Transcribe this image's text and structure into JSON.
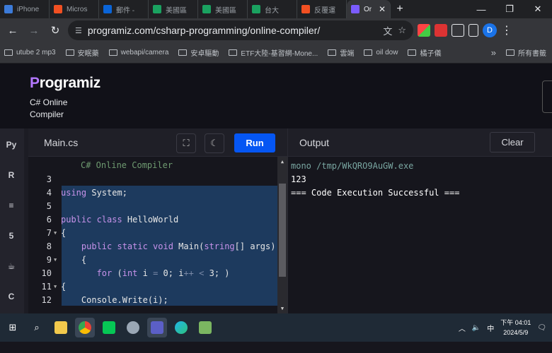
{
  "browser": {
    "tabs": [
      {
        "label": "iPhone",
        "color": "#3c7bd9"
      },
      {
        "label": "Micros",
        "color": "#f25022"
      },
      {
        "label": "郵件 -",
        "color": "#0a64d8"
      },
      {
        "label": "美國區",
        "color": "#1aa260"
      },
      {
        "label": "美國區",
        "color": "#1aa260"
      },
      {
        "label": "台大",
        "color": "#1aa260"
      },
      {
        "label": "反覆運",
        "color": "#f25022"
      },
      {
        "label": "Or",
        "color": "#7b5cff"
      }
    ],
    "new_tab": "+",
    "window_controls": {
      "minimize": "—",
      "restore": "❐",
      "close": "✕"
    },
    "url": "programiz.com/csharp-programming/online-compiler/",
    "avatar_letter": "D"
  },
  "bookmarks": {
    "items": [
      "utube 2 mp3",
      "安眠藥",
      "webapi/camera",
      "安卓驅動",
      "ETF大陸-基習網-Mone...",
      "雲端",
      "oil dow",
      "橘子儀"
    ],
    "overflow": "»",
    "all_bookmarks": "所有書籤"
  },
  "header": {
    "logo_prefix": "P",
    "logo_rest": "rogramiz",
    "subtitle": "C# Online Compiler"
  },
  "languages": [
    "python-icon",
    "r-icon",
    "sql-icon",
    "html-icon",
    "java-icon",
    "c-icon"
  ],
  "editor": {
    "file_tab": "Main.cs",
    "run_label": "Run",
    "header_comment": "C# Online Compiler"
  },
  "output": {
    "title": "Output",
    "clear_label": "Clear",
    "lines": [
      "mono /tmp/WkQRO9AuGW.exe",
      "123",
      "=== Code Execution Successful ==="
    ]
  },
  "taskbar": {
    "time": "下午 04:01",
    "date": "2024/5/9",
    "ime": "中"
  }
}
